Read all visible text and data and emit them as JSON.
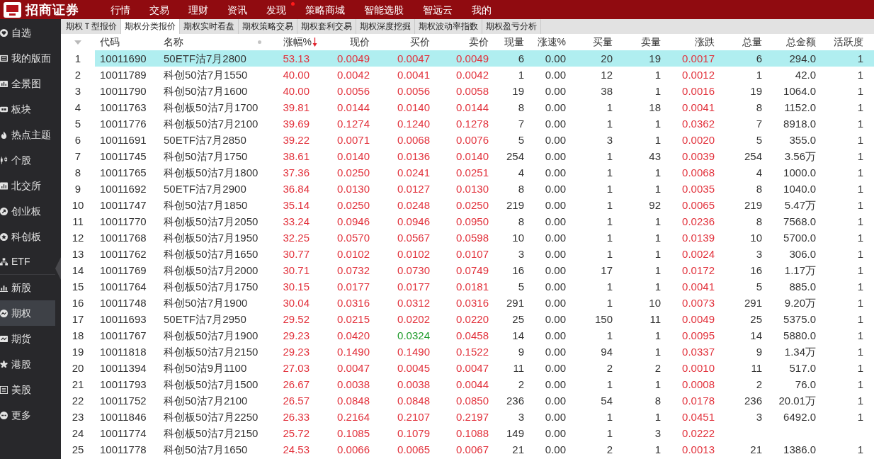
{
  "top_bar": {
    "brand": "招商证券",
    "menu": [
      {
        "label": "行情",
        "notice": false
      },
      {
        "label": "交易",
        "notice": false
      },
      {
        "label": "理财",
        "notice": false
      },
      {
        "label": "资讯",
        "notice": false
      },
      {
        "label": "发现",
        "notice": true
      },
      {
        "label": "策略商城",
        "notice": false
      },
      {
        "label": "智能选股",
        "notice": false
      },
      {
        "label": "智远云",
        "notice": false
      },
      {
        "label": "我的",
        "notice": false
      }
    ]
  },
  "sidebar": {
    "items": [
      {
        "label": "自选",
        "selected": false
      },
      {
        "label": "我的版面",
        "selected": false
      },
      {
        "label": "全景图",
        "selected": false
      },
      {
        "label": "板块",
        "selected": false
      },
      {
        "label": "热点主题",
        "selected": false
      },
      {
        "label": "个股",
        "selected": false
      },
      {
        "label": "北交所",
        "selected": false
      },
      {
        "label": "创业板",
        "selected": false
      },
      {
        "label": "科创板",
        "selected": false
      },
      {
        "label": "ETF",
        "selected": false
      },
      {
        "label": "新股",
        "selected": false
      },
      {
        "label": "期权",
        "selected": true
      },
      {
        "label": "期货",
        "selected": false
      },
      {
        "label": "港股",
        "selected": false
      },
      {
        "label": "美股",
        "selected": false
      },
      {
        "label": "更多",
        "selected": false
      }
    ]
  },
  "tabs": [
    {
      "label": "期权Ｔ型报价",
      "selected": false
    },
    {
      "label": "期权分类报价",
      "selected": true
    },
    {
      "label": "期权实时看盘",
      "selected": false
    },
    {
      "label": "期权策略交易",
      "selected": false
    },
    {
      "label": "期权套利交易",
      "selected": false
    },
    {
      "label": "期权深度挖掘",
      "selected": false
    },
    {
      "label": "期权波动率指数",
      "selected": false
    },
    {
      "label": "期权盈亏分析",
      "selected": false
    }
  ],
  "table": {
    "columns": [
      {
        "kind": "menu"
      },
      {
        "kind": "label",
        "label": "代码"
      },
      {
        "kind": "label",
        "label": "名称",
        "marker": true
      },
      {
        "kind": "label",
        "label": "涨幅%",
        "sort_descending": true
      },
      {
        "kind": "label",
        "label": "现价"
      },
      {
        "kind": "label",
        "label": "买价"
      },
      {
        "kind": "label",
        "label": "卖价"
      },
      {
        "kind": "label",
        "label": "现量"
      },
      {
        "kind": "label",
        "label": "涨速%"
      },
      {
        "kind": "label",
        "label": "买量"
      },
      {
        "kind": "label",
        "label": "卖量"
      },
      {
        "kind": "label",
        "label": "涨跌"
      },
      {
        "kind": "label",
        "label": "总量"
      },
      {
        "kind": "label",
        "label": "总金额"
      },
      {
        "kind": "label",
        "label": "活跃度"
      }
    ],
    "rows": [
      {
        "selected": true,
        "rising": true,
        "bid_rising": true,
        "ask_rising": true,
        "cells": [
          "1",
          "10011690",
          "50ETF沽7月2800",
          "53.13",
          "0.0049",
          "0.0047",
          "0.0049",
          "6",
          "0.00",
          "20",
          "19",
          "0.0017",
          "6",
          "294.0",
          "1"
        ]
      },
      {
        "selected": false,
        "rising": true,
        "bid_rising": true,
        "ask_rising": true,
        "cells": [
          "2",
          "10011789",
          "科创50沽7月1550",
          "40.00",
          "0.0042",
          "0.0041",
          "0.0042",
          "1",
          "0.00",
          "12",
          "1",
          "0.0012",
          "1",
          "42.0",
          "1"
        ]
      },
      {
        "selected": false,
        "rising": true,
        "bid_rising": true,
        "ask_rising": true,
        "cells": [
          "3",
          "10011790",
          "科创50沽7月1600",
          "40.00",
          "0.0056",
          "0.0056",
          "0.0058",
          "19",
          "0.00",
          "38",
          "1",
          "0.0016",
          "19",
          "1064.0",
          "1"
        ]
      },
      {
        "selected": false,
        "rising": true,
        "bid_rising": true,
        "ask_rising": true,
        "cells": [
          "4",
          "10011763",
          "科创板50沽7月1700",
          "39.81",
          "0.0144",
          "0.0140",
          "0.0144",
          "8",
          "0.00",
          "1",
          "18",
          "0.0041",
          "8",
          "1152.0",
          "1"
        ]
      },
      {
        "selected": false,
        "rising": true,
        "bid_rising": true,
        "ask_rising": true,
        "cells": [
          "5",
          "10011776",
          "科创板50沽7月2100",
          "39.69",
          "0.1274",
          "0.1240",
          "0.1278",
          "7",
          "0.00",
          "1",
          "1",
          "0.0362",
          "7",
          "8918.0",
          "1"
        ]
      },
      {
        "selected": false,
        "rising": true,
        "bid_rising": true,
        "ask_rising": true,
        "cells": [
          "6",
          "10011691",
          "50ETF沽7月2850",
          "39.22",
          "0.0071",
          "0.0068",
          "0.0076",
          "5",
          "0.00",
          "3",
          "1",
          "0.0020",
          "5",
          "355.0",
          "1"
        ]
      },
      {
        "selected": false,
        "rising": true,
        "bid_rising": true,
        "ask_rising": true,
        "cells": [
          "7",
          "10011745",
          "科创50沽7月1750",
          "38.61",
          "0.0140",
          "0.0136",
          "0.0140",
          "254",
          "0.00",
          "1",
          "43",
          "0.0039",
          "254",
          "3.56万",
          "1"
        ]
      },
      {
        "selected": false,
        "rising": true,
        "bid_rising": true,
        "ask_rising": true,
        "cells": [
          "8",
          "10011765",
          "科创板50沽7月1800",
          "37.36",
          "0.0250",
          "0.0241",
          "0.0251",
          "4",
          "0.00",
          "1",
          "1",
          "0.0068",
          "4",
          "1000.0",
          "1"
        ]
      },
      {
        "selected": false,
        "rising": true,
        "bid_rising": true,
        "ask_rising": true,
        "cells": [
          "9",
          "10011692",
          "50ETF沽7月2900",
          "36.84",
          "0.0130",
          "0.0127",
          "0.0130",
          "8",
          "0.00",
          "1",
          "1",
          "0.0035",
          "8",
          "1040.0",
          "1"
        ]
      },
      {
        "selected": false,
        "rising": true,
        "bid_rising": true,
        "ask_rising": true,
        "cells": [
          "10",
          "10011747",
          "科创50沽7月1850",
          "35.14",
          "0.0250",
          "0.0248",
          "0.0250",
          "219",
          "0.00",
          "1",
          "92",
          "0.0065",
          "219",
          "5.47万",
          "1"
        ]
      },
      {
        "selected": false,
        "rising": true,
        "bid_rising": true,
        "ask_rising": true,
        "cells": [
          "11",
          "10011770",
          "科创板50沽7月2050",
          "33.24",
          "0.0946",
          "0.0946",
          "0.0950",
          "8",
          "0.00",
          "1",
          "1",
          "0.0236",
          "8",
          "7568.0",
          "1"
        ]
      },
      {
        "selected": false,
        "rising": true,
        "bid_rising": true,
        "ask_rising": true,
        "cells": [
          "12",
          "10011768",
          "科创板50沽7月1950",
          "32.25",
          "0.0570",
          "0.0567",
          "0.0598",
          "10",
          "0.00",
          "1",
          "1",
          "0.0139",
          "10",
          "5700.0",
          "1"
        ]
      },
      {
        "selected": false,
        "rising": true,
        "bid_rising": true,
        "ask_rising": true,
        "cells": [
          "13",
          "10011762",
          "科创板50沽7月1650",
          "30.77",
          "0.0102",
          "0.0102",
          "0.0107",
          "3",
          "0.00",
          "1",
          "1",
          "0.0024",
          "3",
          "306.0",
          "1"
        ]
      },
      {
        "selected": false,
        "rising": true,
        "bid_rising": true,
        "ask_rising": true,
        "cells": [
          "14",
          "10011769",
          "科创板50沽7月2000",
          "30.71",
          "0.0732",
          "0.0730",
          "0.0749",
          "16",
          "0.00",
          "17",
          "1",
          "0.0172",
          "16",
          "1.17万",
          "1"
        ]
      },
      {
        "selected": false,
        "rising": true,
        "bid_rising": true,
        "ask_rising": true,
        "cells": [
          "15",
          "10011764",
          "科创板50沽7月1750",
          "30.15",
          "0.0177",
          "0.0177",
          "0.0181",
          "5",
          "0.00",
          "1",
          "1",
          "0.0041",
          "5",
          "885.0",
          "1"
        ]
      },
      {
        "selected": false,
        "rising": true,
        "bid_rising": true,
        "ask_rising": true,
        "cells": [
          "16",
          "10011748",
          "科创50沽7月1900",
          "30.04",
          "0.0316",
          "0.0312",
          "0.0316",
          "291",
          "0.00",
          "1",
          "10",
          "0.0073",
          "291",
          "9.20万",
          "1"
        ]
      },
      {
        "selected": false,
        "rising": true,
        "bid_rising": true,
        "ask_rising": true,
        "cells": [
          "17",
          "10011693",
          "50ETF沽7月2950",
          "29.52",
          "0.0215",
          "0.0202",
          "0.0220",
          "25",
          "0.00",
          "150",
          "11",
          "0.0049",
          "25",
          "5375.0",
          "1"
        ]
      },
      {
        "selected": false,
        "rising": true,
        "bid_rising": false,
        "ask_rising": true,
        "cells": [
          "18",
          "10011767",
          "科创板50沽7月1900",
          "29.23",
          "0.0420",
          "0.0324",
          "0.0458",
          "14",
          "0.00",
          "1",
          "1",
          "0.0095",
          "14",
          "5880.0",
          "1"
        ]
      },
      {
        "selected": false,
        "rising": true,
        "bid_rising": true,
        "ask_rising": true,
        "cells": [
          "19",
          "10011818",
          "科创板50沽7月2150",
          "29.23",
          "0.1490",
          "0.1490",
          "0.1522",
          "9",
          "0.00",
          "94",
          "1",
          "0.0337",
          "9",
          "1.34万",
          "1"
        ]
      },
      {
        "selected": false,
        "rising": true,
        "bid_rising": true,
        "ask_rising": true,
        "cells": [
          "20",
          "10011394",
          "科创50沽9月1100",
          "27.03",
          "0.0047",
          "0.0045",
          "0.0047",
          "11",
          "0.00",
          "2",
          "2",
          "0.0010",
          "11",
          "517.0",
          "1"
        ]
      },
      {
        "selected": false,
        "rising": true,
        "bid_rising": true,
        "ask_rising": true,
        "cells": [
          "21",
          "10011793",
          "科创板50沽7月1500",
          "26.67",
          "0.0038",
          "0.0038",
          "0.0044",
          "2",
          "0.00",
          "1",
          "1",
          "0.0008",
          "2",
          "76.0",
          "1"
        ]
      },
      {
        "selected": false,
        "rising": true,
        "bid_rising": true,
        "ask_rising": true,
        "cells": [
          "22",
          "10011752",
          "科创50沽7月2100",
          "26.57",
          "0.0848",
          "0.0848",
          "0.0850",
          "236",
          "0.00",
          "54",
          "8",
          "0.0178",
          "236",
          "20.01万",
          "1"
        ]
      },
      {
        "selected": false,
        "rising": true,
        "bid_rising": true,
        "ask_rising": true,
        "cells": [
          "23",
          "10011846",
          "科创板50沽7月2250",
          "26.33",
          "0.2164",
          "0.2107",
          "0.2197",
          "3",
          "0.00",
          "1",
          "1",
          "0.0451",
          "3",
          "6492.0",
          "1"
        ]
      },
      {
        "selected": false,
        "rising": true,
        "bid_rising": true,
        "ask_rising": true,
        "cells": [
          "24",
          "10011774",
          "科创板50沽7月2150",
          "25.72",
          "0.1085",
          "0.1079",
          "0.1088",
          "149",
          "0.00",
          "1",
          "3",
          "0.0222"
        ]
      },
      {
        "selected": false,
        "rising": true,
        "bid_rising": true,
        "ask_rising": true,
        "cells": [
          "25",
          "10011778",
          "科创50沽7月1650",
          "24.53",
          "0.0066",
          "0.0065",
          "0.0067",
          "21",
          "0.00",
          "2",
          "1",
          "0.0013",
          "21",
          "1386.0",
          "1"
        ]
      }
    ]
  }
}
